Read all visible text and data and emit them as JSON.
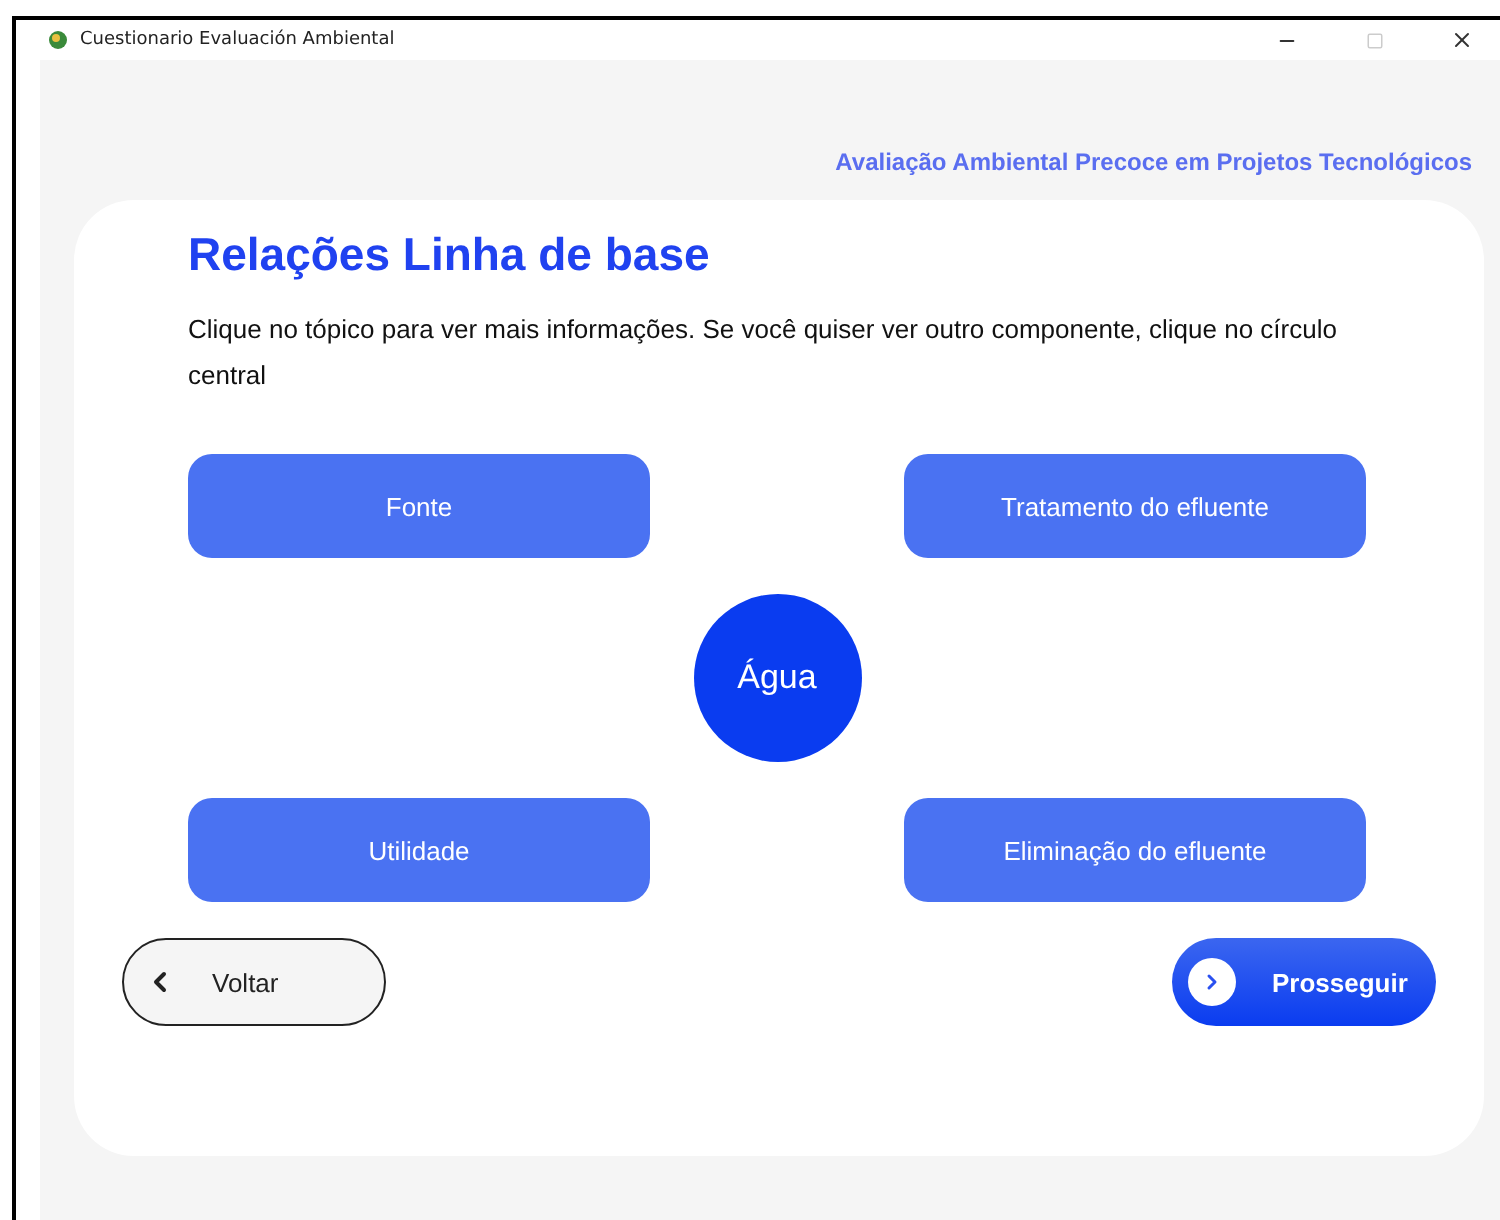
{
  "window": {
    "title": "Cuestionario Evaluación Ambiental"
  },
  "header": {
    "subtitle": "Avaliação Ambiental Precoce em Projetos Tecnológicos"
  },
  "content": {
    "title": "Relações Linha de base",
    "instructions": "Clique no tópico para ver mais informações. Se você quiser ver outro componente, clique no círculo central",
    "topics": [
      {
        "label": "Fonte"
      },
      {
        "label": "Tratamento do efluente"
      },
      {
        "label": "Utilidade"
      },
      {
        "label": "Eliminação do efluente"
      }
    ],
    "center": {
      "label": "Água"
    }
  },
  "buttons": {
    "back": "Voltar",
    "next": "Prosseguir"
  }
}
